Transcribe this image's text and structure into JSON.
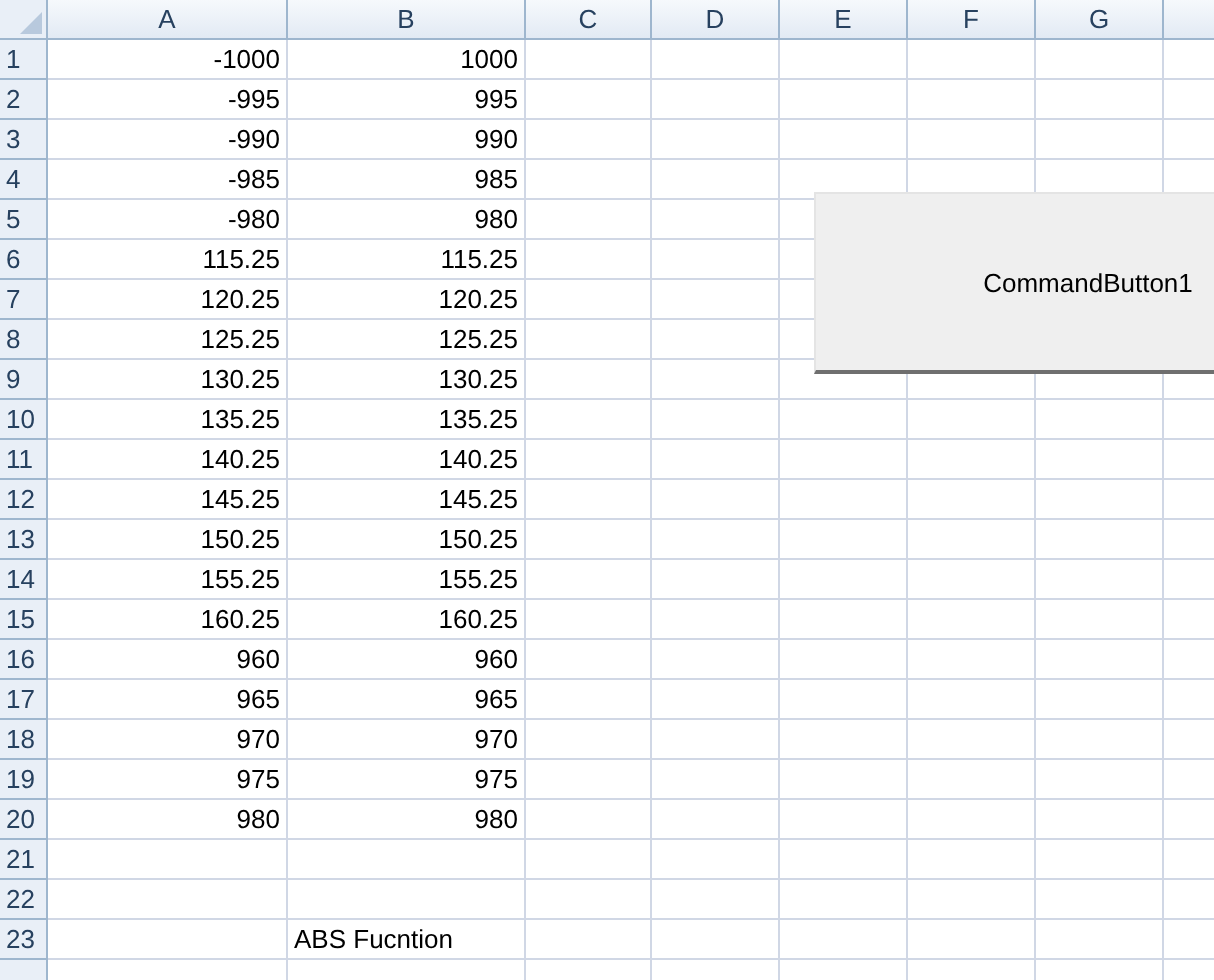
{
  "columns": [
    "A",
    "B",
    "C",
    "D",
    "E",
    "F",
    "G"
  ],
  "rows": [
    {
      "number": "1",
      "cells": [
        {
          "value": "-1000",
          "kind": "number"
        },
        {
          "value": "1000",
          "kind": "number"
        }
      ]
    },
    {
      "number": "2",
      "cells": [
        {
          "value": "-995",
          "kind": "number"
        },
        {
          "value": "995",
          "kind": "number"
        }
      ]
    },
    {
      "number": "3",
      "cells": [
        {
          "value": "-990",
          "kind": "number"
        },
        {
          "value": "990",
          "kind": "number"
        }
      ]
    },
    {
      "number": "4",
      "cells": [
        {
          "value": "-985",
          "kind": "number"
        },
        {
          "value": "985",
          "kind": "number"
        }
      ]
    },
    {
      "number": "5",
      "cells": [
        {
          "value": "-980",
          "kind": "number"
        },
        {
          "value": "980",
          "kind": "number"
        }
      ]
    },
    {
      "number": "6",
      "cells": [
        {
          "value": "115.25",
          "kind": "number"
        },
        {
          "value": "115.25",
          "kind": "number"
        }
      ]
    },
    {
      "number": "7",
      "cells": [
        {
          "value": "120.25",
          "kind": "number"
        },
        {
          "value": "120.25",
          "kind": "number"
        }
      ]
    },
    {
      "number": "8",
      "cells": [
        {
          "value": "125.25",
          "kind": "number"
        },
        {
          "value": "125.25",
          "kind": "number"
        }
      ]
    },
    {
      "number": "9",
      "cells": [
        {
          "value": "130.25",
          "kind": "number"
        },
        {
          "value": "130.25",
          "kind": "number"
        }
      ]
    },
    {
      "number": "10",
      "cells": [
        {
          "value": "135.25",
          "kind": "number"
        },
        {
          "value": "135.25",
          "kind": "number"
        }
      ]
    },
    {
      "number": "11",
      "cells": [
        {
          "value": "140.25",
          "kind": "number"
        },
        {
          "value": "140.25",
          "kind": "number"
        }
      ]
    },
    {
      "number": "12",
      "cells": [
        {
          "value": "145.25",
          "kind": "number"
        },
        {
          "value": "145.25",
          "kind": "number"
        }
      ]
    },
    {
      "number": "13",
      "cells": [
        {
          "value": "150.25",
          "kind": "number"
        },
        {
          "value": "150.25",
          "kind": "number"
        }
      ]
    },
    {
      "number": "14",
      "cells": [
        {
          "value": "155.25",
          "kind": "number"
        },
        {
          "value": "155.25",
          "kind": "number"
        }
      ]
    },
    {
      "number": "15",
      "cells": [
        {
          "value": "160.25",
          "kind": "number"
        },
        {
          "value": "160.25",
          "kind": "number"
        }
      ]
    },
    {
      "number": "16",
      "cells": [
        {
          "value": "960",
          "kind": "number"
        },
        {
          "value": "960",
          "kind": "number"
        }
      ]
    },
    {
      "number": "17",
      "cells": [
        {
          "value": "965",
          "kind": "number"
        },
        {
          "value": "965",
          "kind": "number"
        }
      ]
    },
    {
      "number": "18",
      "cells": [
        {
          "value": "970",
          "kind": "number"
        },
        {
          "value": "970",
          "kind": "number"
        }
      ]
    },
    {
      "number": "19",
      "cells": [
        {
          "value": "975",
          "kind": "number"
        },
        {
          "value": "975",
          "kind": "number"
        }
      ]
    },
    {
      "number": "20",
      "cells": [
        {
          "value": "980",
          "kind": "number"
        },
        {
          "value": "980",
          "kind": "number"
        }
      ]
    },
    {
      "number": "21",
      "cells": []
    },
    {
      "number": "22",
      "cells": []
    },
    {
      "number": "23",
      "cells": [
        {
          "kind": "blank"
        },
        {
          "value": "ABS Fucntion",
          "kind": "text"
        }
      ]
    }
  ],
  "command_button": {
    "label": "CommandButton1"
  }
}
